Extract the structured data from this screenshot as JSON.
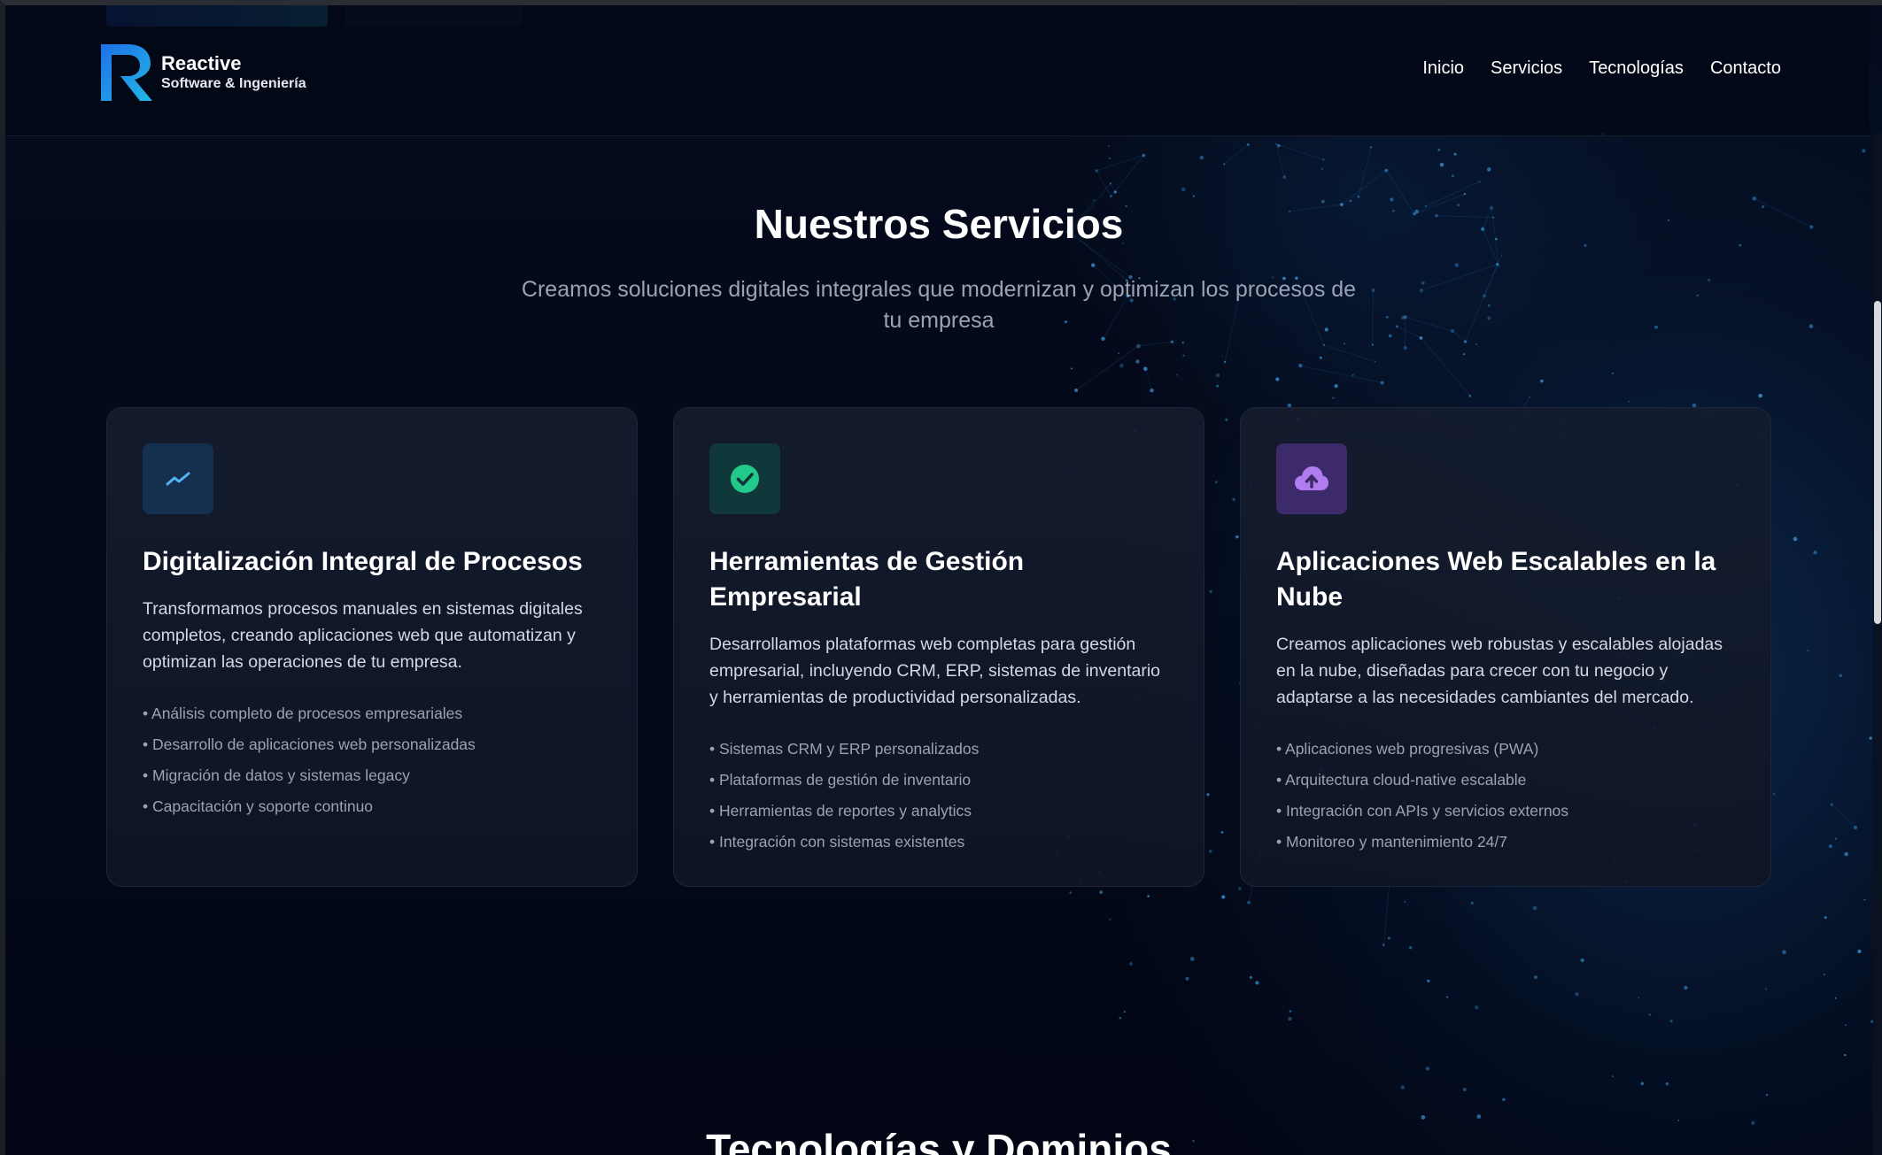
{
  "brand": {
    "name": "Reactive",
    "tagline": "Software & Ingeniería"
  },
  "nav": {
    "items": [
      "Inicio",
      "Servicios",
      "Tecnologías",
      "Contacto"
    ]
  },
  "services": {
    "title": "Nuestros Servicios",
    "subtitle": "Creamos soluciones digitales integrales que modernizan y optimizan los procesos de tu empresa",
    "cards": [
      {
        "icon": "trend-line-icon",
        "icon_color": "#4fb3f5",
        "title": "Digitalización Integral de Procesos",
        "description": "Transformamos procesos manuales en sistemas digitales completos, creando aplicaciones web que automatizan y optimizan las operaciones de tu empresa.",
        "features": [
          "Análisis completo de procesos empresariales",
          "Desarrollo de aplicaciones web personalizadas",
          "Migración de datos y sistemas legacy",
          "Capacitación y soporte continuo"
        ]
      },
      {
        "icon": "check-circle-icon",
        "icon_color": "#22c98a",
        "title": "Herramientas de Gestión Empresarial",
        "description": "Desarrollamos plataformas web completas para gestión empresarial, incluyendo CRM, ERP, sistemas de inventario y herramientas de productividad personalizadas.",
        "features": [
          "Sistemas CRM y ERP personalizados",
          "Plataformas de gestión de inventario",
          "Herramientas de reportes y analytics",
          "Integración con sistemas existentes"
        ]
      },
      {
        "icon": "cloud-upload-icon",
        "icon_color": "#b07cf0",
        "title": "Aplicaciones Web Escalables en la Nube",
        "description": "Creamos aplicaciones web robustas y escalables alojadas en la nube, diseñadas para crecer con tu negocio y adaptarse a las necesidades cambiantes del mercado.",
        "features": [
          "Aplicaciones web progresivas (PWA)",
          "Arquitectura cloud-native escalable",
          "Integración con APIs y servicios externos",
          "Monitoreo y mantenimiento 24/7"
        ]
      }
    ]
  },
  "next_section": {
    "title": "Tecnologías y Dominios"
  }
}
